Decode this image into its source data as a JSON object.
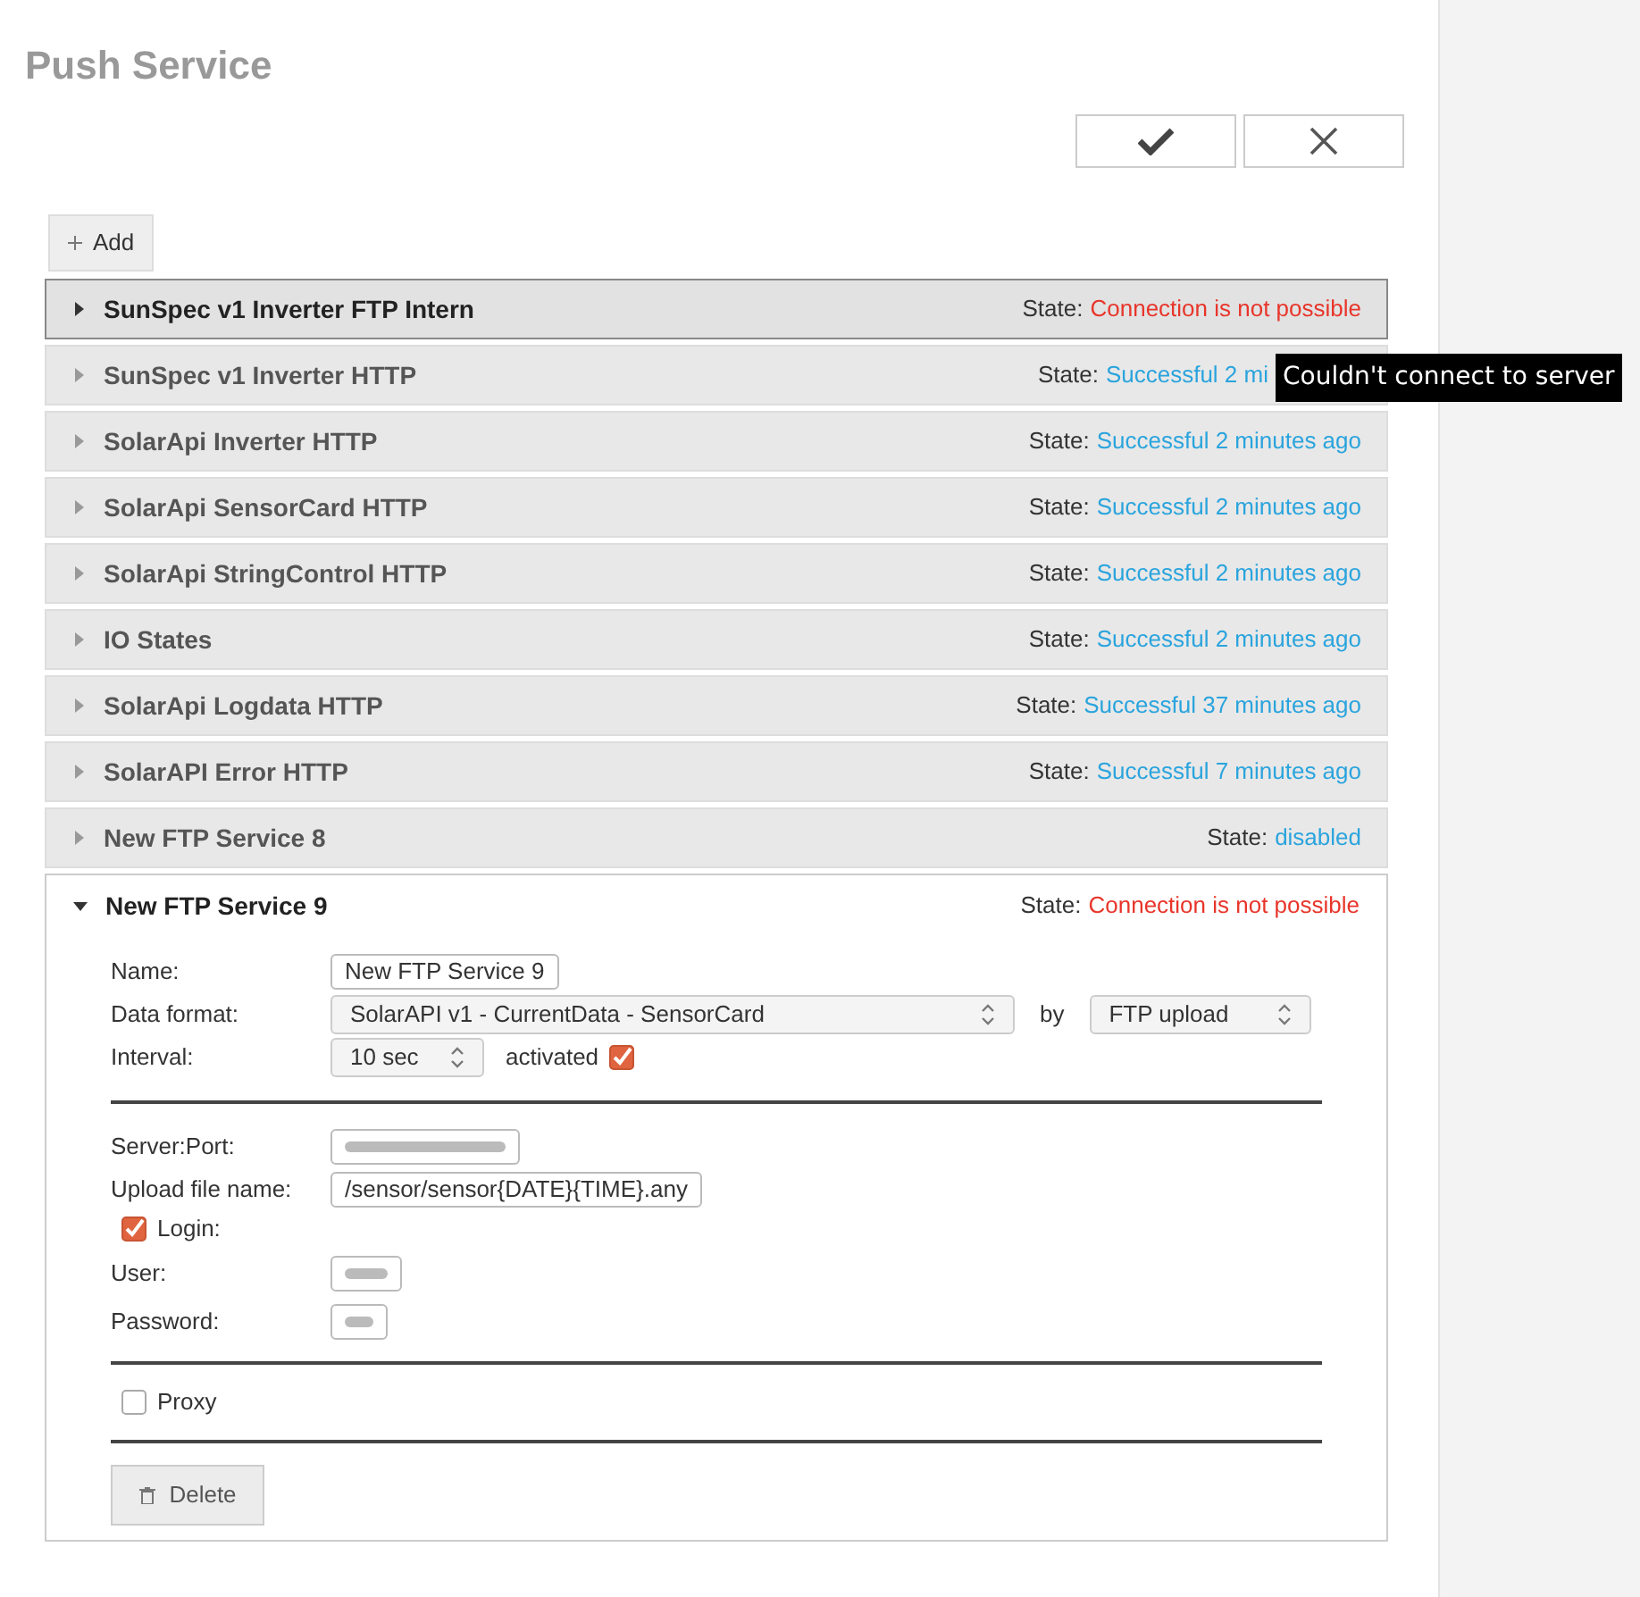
{
  "title": "Push Service",
  "add_button": "Add",
  "services": [
    {
      "name": "SunSpec v1 Inverter FTP Intern",
      "state_label": "State:",
      "state": "Connection is not possible",
      "color": "#e8352a",
      "selected": true,
      "expanded": false
    },
    {
      "name": "SunSpec v1 Inverter HTTP",
      "state_label": "State:",
      "state": "Successful 2 mi",
      "color": "#2aa4dd",
      "selected": false,
      "expanded": false,
      "tooltip": "Couldn't connect to server"
    },
    {
      "name": "SolarApi Inverter HTTP",
      "state_label": "State:",
      "state": "Successful 2 minutes ago",
      "color": "#2aa4dd",
      "selected": false,
      "expanded": false
    },
    {
      "name": "SolarApi SensorCard HTTP",
      "state_label": "State:",
      "state": "Successful 2 minutes ago",
      "color": "#2aa4dd",
      "selected": false,
      "expanded": false
    },
    {
      "name": "SolarApi StringControl HTTP",
      "state_label": "State:",
      "state": "Successful 2 minutes ago",
      "color": "#2aa4dd",
      "selected": false,
      "expanded": false
    },
    {
      "name": "IO States",
      "state_label": "State:",
      "state": "Successful 2 minutes ago",
      "color": "#2aa4dd",
      "selected": false,
      "expanded": false
    },
    {
      "name": "SolarApi Logdata HTTP",
      "state_label": "State:",
      "state": "Successful 37 minutes ago",
      "color": "#2aa4dd",
      "selected": false,
      "expanded": false
    },
    {
      "name": "SolarAPI Error HTTP",
      "state_label": "State:",
      "state": "Successful 7 minutes ago",
      "color": "#2aa4dd",
      "selected": false,
      "expanded": false
    },
    {
      "name": "New FTP Service 8",
      "state_label": "State:",
      "state": "disabled",
      "color": "#2aa4dd",
      "selected": false,
      "expanded": false
    },
    {
      "name": "New FTP Service 9",
      "state_label": "State:",
      "state": "Connection is not possible",
      "color": "#e8352a",
      "selected": false,
      "expanded": true
    }
  ],
  "details": {
    "name": {
      "label": "Name:",
      "value": "New FTP Service 9"
    },
    "data_format": {
      "label": "Data format:",
      "value": "SolarAPI v1 - CurrentData - SensorCard"
    },
    "by_label": "by",
    "transport": "FTP upload",
    "interval": {
      "label": "Interval:",
      "value": "10 sec"
    },
    "activated": {
      "label": "activated",
      "checked": true
    },
    "server_port": {
      "label": "Server:Port:"
    },
    "upload_file_name": {
      "label": "Upload file name:",
      "value": "/sensor/sensor{DATE}{TIME}.any"
    },
    "login": {
      "label": "Login:",
      "checked": true
    },
    "user": {
      "label": "User:"
    },
    "password": {
      "label": "Password:"
    },
    "proxy": {
      "label": "Proxy",
      "checked": false
    },
    "delete_button": "Delete"
  }
}
